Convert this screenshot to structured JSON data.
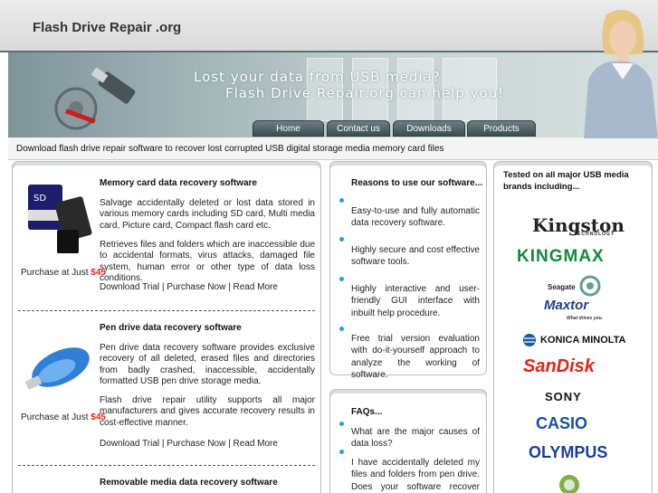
{
  "header": {
    "site_title": "Flash Drive Repair .org"
  },
  "banner": {
    "tagline_line1": "Lost your data from USB media?",
    "tagline_line2": "Flash Drive Repair.org can help you!",
    "nav": [
      "Home",
      "Contact us",
      "Downloads",
      "Products"
    ]
  },
  "intro": "Download flash drive repair software to recover lost corrupted USB digital storage media memory card files",
  "products": [
    {
      "title": "Memory card data recovery software",
      "paragraphs": [
        "Salvage accidentally deleted or lost data stored in various memory cards including SD card, Multi media card, Picture card, Compact flash card etc.",
        "Retrieves files and folders which are inaccessible due to accidental formats, virus attacks, damaged file system, human error or other type of data loss conditions."
      ],
      "price_label": "Purchase at Just",
      "price": "$45",
      "links": "Download Trial | Purchase Now | Read More"
    },
    {
      "title": "Pen drive data recovery software",
      "paragraphs": [
        "Pen drive data recovery software provides exclusive recovery of all deleted, erased files and directories from badly crashed, inaccessible, accidentally formatted USB pen drive storage media.",
        "Flash drive repair utility supports all major manufacturers and gives accurate recovery results in cost-effective manner."
      ],
      "price_label": "Purchase at Just",
      "price": "$45",
      "links": "Download Trial | Purchase Now | Read More"
    },
    {
      "title": "Removable media data recovery software"
    }
  ],
  "reasons": {
    "title": "Reasons to use our software...",
    "items": [
      "Easy-to-use and fully automatic data recovery software.",
      "Highly secure and cost effective software tools.",
      "Highly interactive and user-friendly GUI interface with inbuilt help procedure.",
      "Free trial version evaluation with do-it-yourself approach to analyze the working of software."
    ]
  },
  "faqs": {
    "title": "FAQs...",
    "items": [
      "What are the major causes of data loss?",
      "I have accidentally deleted my files and folders from pen drive. Does your software recover them?"
    ]
  },
  "brands": {
    "title": "Tested on all major USB media brands including...",
    "kingston": "Kingston",
    "kingston_sub": "TECHNOLOGY",
    "kingmax": "KINGMAX",
    "seagate": "Seagate",
    "maxtor": "Maxtor",
    "maxtor_sub": "What drives you.",
    "konica": "KONICA MINOLTA",
    "sandisk": "SanDisk",
    "sony": "SONY",
    "casio": "CASIO",
    "olympus": "OLYMPUS"
  },
  "colors": {
    "price": "#e2231a",
    "bullet": "#2e9fd8",
    "casio": "#1a4fa3",
    "kingmax": "#148a3c",
    "sandisk": "#e2231a"
  }
}
